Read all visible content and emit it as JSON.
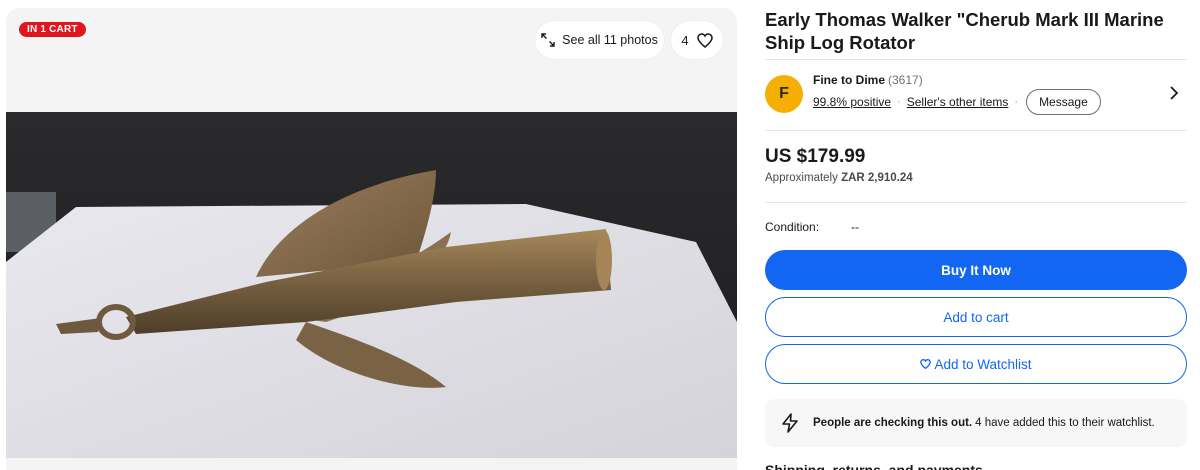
{
  "gallery": {
    "badge": "IN 1 CART",
    "see_all_label": "See all 11 photos",
    "watch_count": "4",
    "icons": {
      "expand": "expand-arrows-icon",
      "heart": "heart-outline-icon"
    }
  },
  "listing": {
    "title": "Early Thomas Walker \"Cherub Mark III Marine Ship Log Rotator"
  },
  "seller": {
    "avatar_letter": "F",
    "name": "Fine to Dime",
    "count": "(3617)",
    "positive": "99.8% positive",
    "other_items": "Seller's other items",
    "message_label": "Message"
  },
  "pricing": {
    "price": "US $179.99",
    "approx_prefix": "Approximately",
    "approx_value": "ZAR 2,910.24"
  },
  "condition": {
    "label": "Condition:",
    "value": "--"
  },
  "actions": {
    "buy_now": "Buy It Now",
    "add_to_cart": "Add to cart",
    "add_to_watchlist": "Add to Watchlist"
  },
  "notice": {
    "bold": "People are checking this out.",
    "text": "4 have added this to their watchlist."
  },
  "next_section_partial": "Shipping, returns, and payments",
  "colors": {
    "accent": "#1266f1",
    "badge": "#e0161f",
    "avatar": "#f5af02"
  }
}
